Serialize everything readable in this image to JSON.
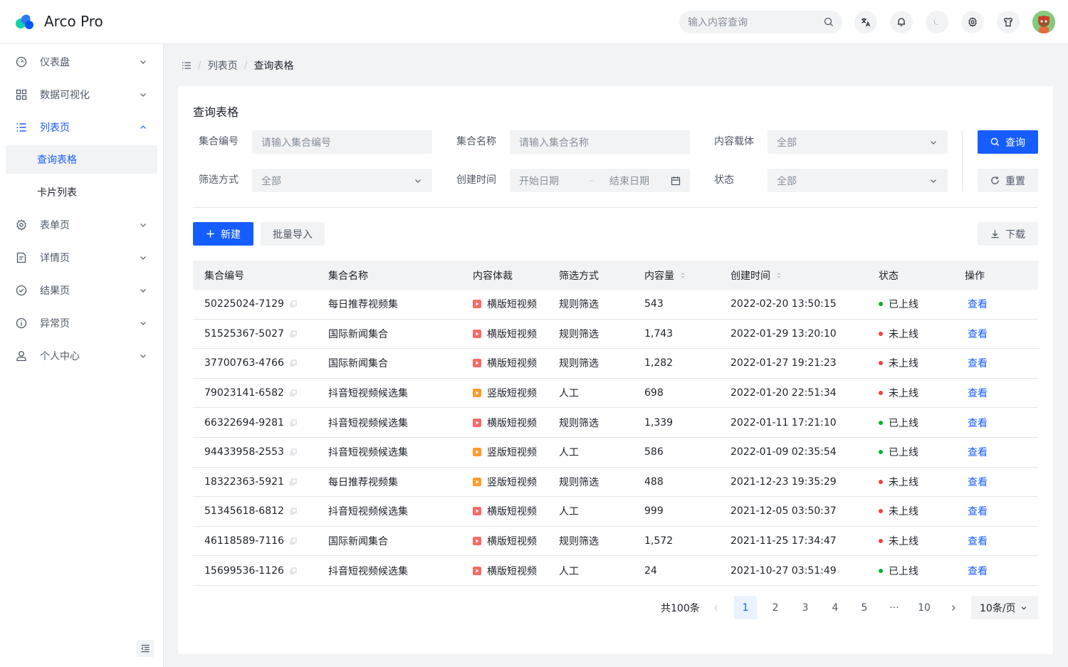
{
  "app": {
    "title": "Arco Pro"
  },
  "header": {
    "search_placeholder": "输入内容查询"
  },
  "sidebar": {
    "items": [
      {
        "label": "仪表盘"
      },
      {
        "label": "数据可视化"
      },
      {
        "label": "列表页"
      },
      {
        "label": "表单页"
      },
      {
        "label": "详情页"
      },
      {
        "label": "结果页"
      },
      {
        "label": "异常页"
      },
      {
        "label": "个人中心"
      }
    ],
    "sub_items": [
      {
        "label": "查询表格"
      },
      {
        "label": "卡片列表"
      }
    ]
  },
  "breadcrumb": {
    "level1": "列表页",
    "level2": "查询表格"
  },
  "card": {
    "title": "查询表格"
  },
  "filters": {
    "id_label": "集合编号",
    "id_placeholder": "请输入集合编号",
    "name_label": "集合名称",
    "name_placeholder": "请输入集合名称",
    "carrier_label": "内容载体",
    "carrier_value": "全部",
    "filter_label": "筛选方式",
    "filter_value": "全部",
    "time_label": "创建时间",
    "start_placeholder": "开始日期",
    "end_placeholder": "结束日期",
    "status_label": "状态",
    "status_value": "全部",
    "query_button": "查询",
    "reset_button": "重置"
  },
  "toolbar": {
    "new_button": "新建",
    "import_button": "批量导入",
    "download_button": "下载"
  },
  "table": {
    "columns": [
      "集合编号",
      "集合名称",
      "内容体裁",
      "筛选方式",
      "内容量",
      "创建时间",
      "状态",
      "操作"
    ],
    "rows": [
      {
        "id": "50225024-7129",
        "name": "每日推荐视频集",
        "genre": "横版短视频",
        "filter": "规则筛选",
        "count": "543",
        "time": "2022-02-20 13:50:15",
        "status": "已上线",
        "action": "查看"
      },
      {
        "id": "51525367-5027",
        "name": "国际新闻集合",
        "genre": "横版短视频",
        "filter": "规则筛选",
        "count": "1,743",
        "time": "2022-01-29 13:20:10",
        "status": "未上线",
        "action": "查看"
      },
      {
        "id": "37700763-4766",
        "name": "国际新闻集合",
        "genre": "横版短视频",
        "filter": "规则筛选",
        "count": "1,282",
        "time": "2022-01-27 19:21:23",
        "status": "未上线",
        "action": "查看"
      },
      {
        "id": "79023141-6582",
        "name": "抖音短视频候选集",
        "genre": "竖版短视频",
        "filter": "人工",
        "count": "698",
        "time": "2022-01-20 22:51:34",
        "status": "未上线",
        "action": "查看"
      },
      {
        "id": "66322694-9281",
        "name": "抖音短视频候选集",
        "genre": "横版短视频",
        "filter": "规则筛选",
        "count": "1,339",
        "time": "2022-01-11 17:21:10",
        "status": "已上线",
        "action": "查看"
      },
      {
        "id": "94433958-2553",
        "name": "抖音短视频候选集",
        "genre": "竖版短视频",
        "filter": "人工",
        "count": "586",
        "time": "2022-01-09 02:35:54",
        "status": "已上线",
        "action": "查看"
      },
      {
        "id": "18322363-5921",
        "name": "每日推荐视频集",
        "genre": "竖版短视频",
        "filter": "规则筛选",
        "count": "488",
        "time": "2021-12-23 19:35:29",
        "status": "未上线",
        "action": "查看"
      },
      {
        "id": "51345618-6812",
        "name": "抖音短视频候选集",
        "genre": "横版短视频",
        "filter": "人工",
        "count": "999",
        "time": "2021-12-05 03:50:37",
        "status": "未上线",
        "action": "查看"
      },
      {
        "id": "46118589-7116",
        "name": "国际新闻集合",
        "genre": "横版短视频",
        "filter": "规则筛选",
        "count": "1,572",
        "time": "2021-11-25 17:34:47",
        "status": "未上线",
        "action": "查看"
      },
      {
        "id": "15699536-1126",
        "name": "抖音短视频候选集",
        "genre": "横版短视频",
        "filter": "人工",
        "count": "24",
        "time": "2021-10-27 03:51:49",
        "status": "已上线",
        "action": "查看"
      }
    ]
  },
  "pagination": {
    "total": "共100条",
    "pages": [
      "1",
      "2",
      "3",
      "4",
      "5",
      "···",
      "10"
    ],
    "page_size": "10条/页"
  },
  "colors": {
    "primary": "#165dff",
    "online": "#00b42a",
    "offline": "#f53f3f",
    "horizontal": "#f76965",
    "vertical": "#ff9a2e"
  }
}
